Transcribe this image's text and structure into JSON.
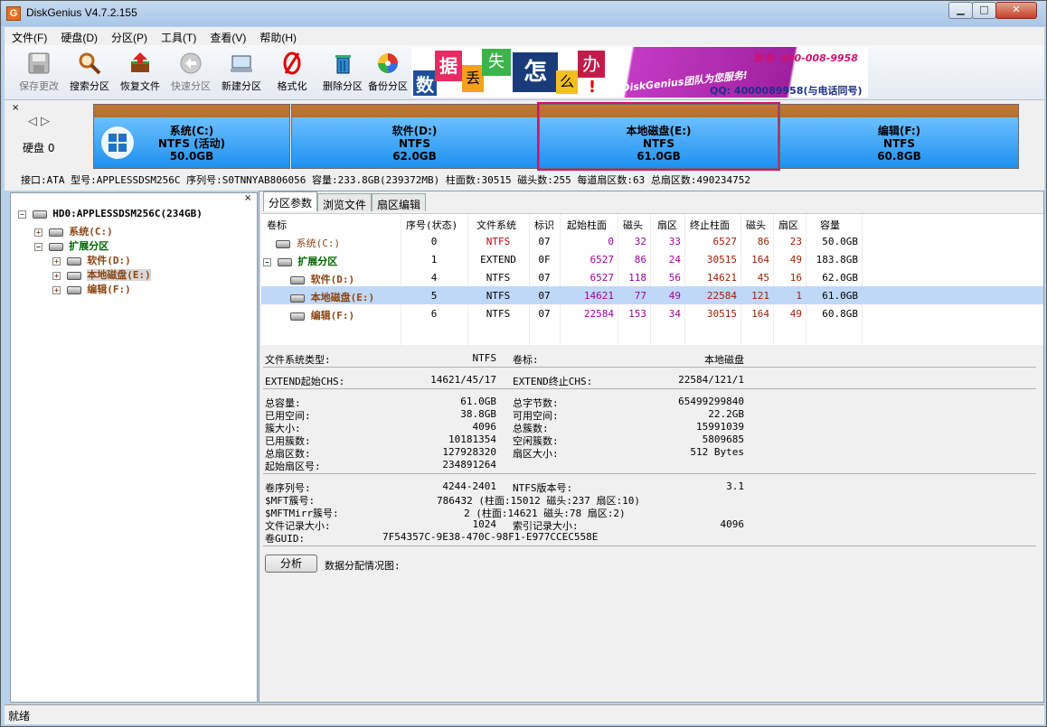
{
  "window": {
    "title": "DiskGenius V4.7.2.155",
    "icon_letter": "G"
  },
  "menu": [
    "文件(F)",
    "硬盘(D)",
    "分区(P)",
    "工具(T)",
    "查看(V)",
    "帮助(H)"
  ],
  "toolbar": [
    {
      "label": "保存更改",
      "icon": "save-icon",
      "enabled": false
    },
    {
      "label": "搜索分区",
      "icon": "search-icon",
      "enabled": true
    },
    {
      "label": "恢复文件",
      "icon": "recover-icon",
      "enabled": true
    },
    {
      "label": "快速分区",
      "icon": "quick-partition-icon",
      "enabled": false
    },
    {
      "label": "新建分区",
      "icon": "new-partition-icon",
      "enabled": true
    },
    {
      "label": "格式化",
      "icon": "format-icon",
      "enabled": true
    },
    {
      "label": "删除分区",
      "icon": "delete-icon",
      "enabled": true
    },
    {
      "label": "备份分区",
      "icon": "backup-icon",
      "enabled": true
    }
  ],
  "banner": {
    "chars": [
      "数",
      "据",
      "丢",
      "失",
      "怎",
      "么",
      "办",
      "!"
    ],
    "team_text": "DiskGenius团队为您服务!",
    "phone_label": "致电: 400-008-9958",
    "qq_text": "QQ: 4000089958(与电话同号)"
  },
  "disk_panel": {
    "disk_label": "硬盘 0",
    "partitions": [
      {
        "name": "系统(C:)",
        "fs": "NTFS (活动)",
        "size": "50.0GB",
        "selected": false
      },
      {
        "name": "软件(D:)",
        "fs": "NTFS",
        "size": "62.0GB",
        "selected": false
      },
      {
        "name": "本地磁盘(E:)",
        "fs": "NTFS",
        "size": "61.0GB",
        "selected": true
      },
      {
        "name": "编辑(F:)",
        "fs": "NTFS",
        "size": "60.8GB",
        "selected": false
      }
    ],
    "info": "接口:ATA  型号:APPLESSDSM256C  序列号:S0TNNYAB806056  容量:233.8GB(239372MB)  柱面数:30515  磁头数:255  每道扇区数:63  总扇区数:490234752"
  },
  "tree": {
    "root": "HD0:APPLESSDSM256C(234GB)",
    "items": [
      {
        "label": "系统(C:)",
        "level": 1
      },
      {
        "label": "扩展分区",
        "level": 1
      },
      {
        "label": "软件(D:)",
        "level": 2
      },
      {
        "label": "本地磁盘(E:)",
        "level": 2,
        "selected": true
      },
      {
        "label": "编辑(F:)",
        "level": 2
      }
    ]
  },
  "tabs": [
    "分区参数",
    "浏览文件",
    "扇区编辑"
  ],
  "table": {
    "headers": [
      "卷标",
      "序号(状态)",
      "文件系统",
      "标识",
      "起始柱面",
      "磁头",
      "扇区",
      "终止柱面",
      "磁头",
      "扇区",
      "容量"
    ],
    "rows": [
      {
        "name": "系统(C:)",
        "idx": "0",
        "fs": "NTFS",
        "id": "07",
        "sc": "0",
        "sh": "32",
        "ss": "33",
        "ec": "6527",
        "eh": "86",
        "es": "23",
        "cap": "50.0GB"
      },
      {
        "name": "扩展分区",
        "idx": "1",
        "fs": "EXTEND",
        "id": "0F",
        "sc": "6527",
        "sh": "86",
        "ss": "24",
        "ec": "30515",
        "eh": "164",
        "es": "49",
        "cap": "183.8GB"
      },
      {
        "name": "软件(D:)",
        "idx": "4",
        "fs": "NTFS",
        "id": "07",
        "sc": "6527",
        "sh": "118",
        "ss": "56",
        "ec": "14621",
        "eh": "45",
        "es": "16",
        "cap": "62.0GB"
      },
      {
        "name": "本地磁盘(E:)",
        "idx": "5",
        "fs": "NTFS",
        "id": "07",
        "sc": "14621",
        "sh": "77",
        "ss": "49",
        "ec": "22584",
        "eh": "121",
        "es": "1",
        "cap": "61.0GB"
      },
      {
        "name": "编辑(F:)",
        "idx": "6",
        "fs": "NTFS",
        "id": "07",
        "sc": "22584",
        "sh": "153",
        "ss": "34",
        "ec": "30515",
        "eh": "164",
        "es": "49",
        "cap": "60.8GB"
      }
    ]
  },
  "details": {
    "fs_type_label": "文件系统类型:",
    "fs_type": "NTFS",
    "vol_label_label": "卷标:",
    "vol_label": "本地磁盘",
    "ext_start_label": "EXTEND起始CHS:",
    "ext_start": "14621/45/17",
    "ext_end_label": "EXTEND终止CHS:",
    "ext_end": "22584/121/1",
    "left_block": [
      [
        "总容量:",
        "61.0GB"
      ],
      [
        "已用空间:",
        "38.8GB"
      ],
      [
        "簇大小:",
        "4096"
      ],
      [
        "已用簇数:",
        "10181354"
      ],
      [
        "总扇区数:",
        "127928320"
      ],
      [
        "起始扇区号:",
        "234891264"
      ]
    ],
    "right_block": [
      [
        "总字节数:",
        "65499299840"
      ],
      [
        "可用空间:",
        "22.2GB"
      ],
      [
        "总簇数:",
        "15991039"
      ],
      [
        "空闲簇数:",
        "5809685"
      ],
      [
        "扇区大小:",
        "512 Bytes"
      ]
    ],
    "serial_label": "卷序列号:",
    "serial": "4244-2401",
    "ntfs_ver_label": "NTFS版本号:",
    "ntfs_ver": "3.1",
    "mft_label": "$MFT簇号:",
    "mft": "786432 (柱面:15012 磁头:237 扇区:10)",
    "mftmirr_label": "$MFTMirr簇号:",
    "mftmirr": "2 (柱面:14621 磁头:78 扇区:2)",
    "record_label": "文件记录大小:",
    "record": "1024",
    "index_label": "索引记录大小:",
    "index": "4096",
    "guid_label": "卷GUID:",
    "guid": "7F54357C-9E38-470C-98F1-E977CCEC558E",
    "analyze_button": "分析",
    "alloc_label": "数据分配情况图:"
  },
  "status": "就绪",
  "colors": {
    "accent_red": "#c00000",
    "purple": "#a000a0",
    "brown": "#8b4513",
    "green": "#006400",
    "selection": "#c0d8f8"
  }
}
